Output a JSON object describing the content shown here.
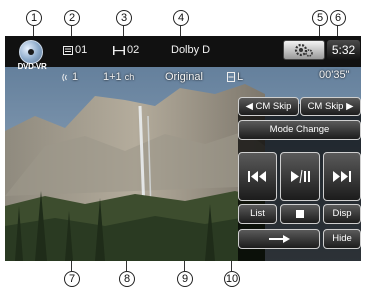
{
  "callouts": [
    "1",
    "2",
    "3",
    "4",
    "5",
    "6",
    "7",
    "8",
    "9",
    "10"
  ],
  "status_bar": {
    "disc_label": "DVD-VR",
    "title_number": "01",
    "chapter_number": "02",
    "audio_format": "Dolby D",
    "clock": "5:32",
    "elapsed_time": "00'35\""
  },
  "info_row": {
    "audio_language": "1",
    "channels": "1+1",
    "channels_unit": "ch",
    "audio_output": "Original",
    "dual_mono": "L"
  },
  "controls": {
    "cm_skip_back": "CM Skip",
    "cm_skip_forward": "CM Skip",
    "mode_change": "Mode Change",
    "list": "List",
    "disp": "Disp",
    "hide": "Hide"
  },
  "icons": [
    "disc-icon",
    "title-icon",
    "chapter-icon",
    "settings-icon",
    "subtitle-icon",
    "dual-mono-icon",
    "skip-back-icon",
    "play-pause-icon",
    "skip-forward-icon",
    "stop-icon",
    "arrow-right-icon"
  ]
}
